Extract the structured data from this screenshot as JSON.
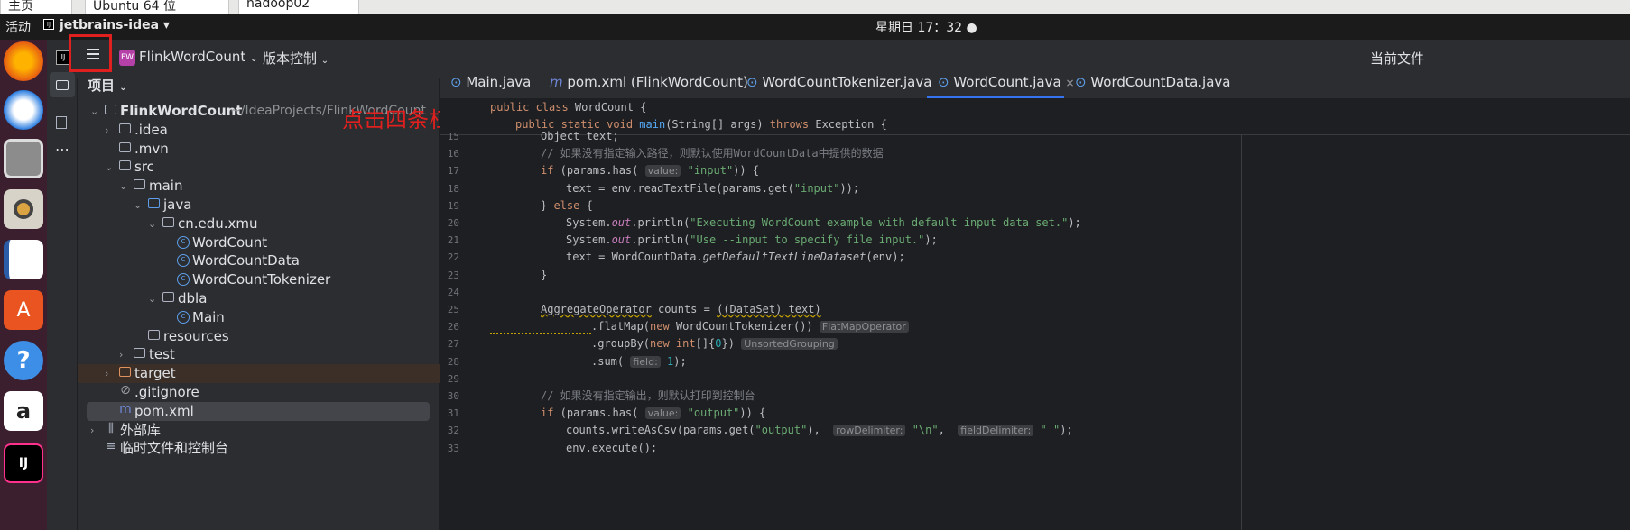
{
  "browser_tabs": [
    "主页",
    "Ubuntu 64 位",
    "hadoop02"
  ],
  "gnome": {
    "activities": "活动",
    "app": "jetbrains-idea",
    "clock": "星期日 17：32"
  },
  "ide": {
    "project_badge": "FW",
    "project_name": "FlinkWordCount",
    "vcs": "版本控制",
    "current_file": "当前文件"
  },
  "annotation": "点击四条杠",
  "panel_title": "项目",
  "tree": [
    {
      "label": "FlinkWordCount",
      "path": "~/IdeaProjects/FlinkWordCount",
      "type": "folder",
      "open": true
    },
    {
      "label": ".idea",
      "type": "folder"
    },
    {
      "label": ".mvn",
      "type": "folder"
    },
    {
      "label": "src",
      "type": "folder",
      "open": true
    },
    {
      "label": "main",
      "type": "folder",
      "open": true
    },
    {
      "label": "java",
      "type": "folder",
      "open": true
    },
    {
      "label": "cn.edu.xmu",
      "type": "package",
      "open": true
    },
    {
      "label": "WordCount",
      "type": "class"
    },
    {
      "label": "WordCountData",
      "type": "class"
    },
    {
      "label": "WordCountTokenizer",
      "type": "class"
    },
    {
      "label": "dbla",
      "type": "package",
      "open": true
    },
    {
      "label": "Main",
      "type": "class"
    },
    {
      "label": "resources",
      "type": "folder"
    },
    {
      "label": "test",
      "type": "folder"
    },
    {
      "label": "target",
      "type": "folder"
    },
    {
      "label": ".gitignore",
      "type": "file"
    },
    {
      "label": "pom.xml",
      "type": "file"
    },
    {
      "label": "外部库",
      "type": "lib"
    },
    {
      "label": "临时文件和控制台",
      "type": "scratch"
    }
  ],
  "editor_tabs": [
    "Main.java",
    "pom.xml (FlinkWordCount)",
    "WordCountTokenizer.java",
    "WordCount.java",
    "WordCountData.java"
  ],
  "active_tab": "WordCount.java",
  "sticky": [
    "public class WordCount {",
    "    public static void main(String[] args) throws Exception {"
  ],
  "lines": {
    "first": 15,
    "last": 33
  }
}
